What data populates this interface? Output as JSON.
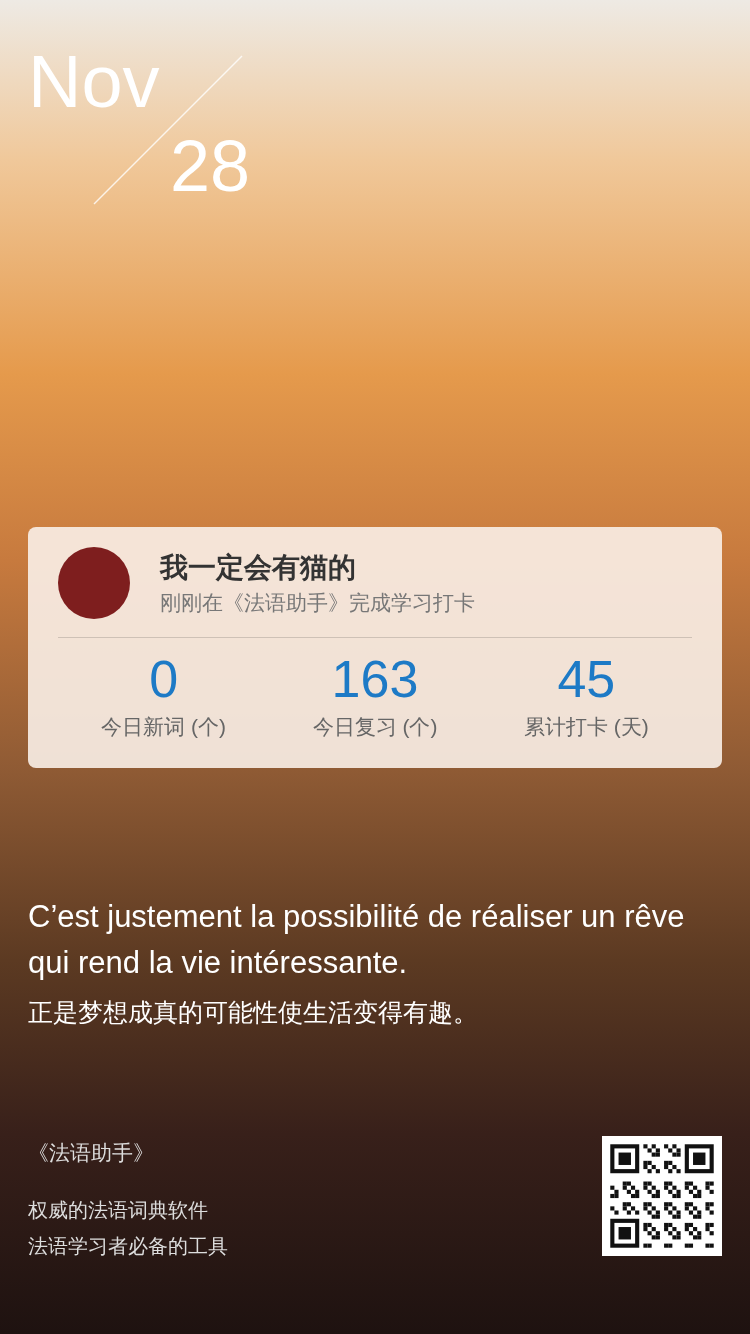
{
  "date": {
    "month": "Nov",
    "day": "28"
  },
  "card": {
    "user_name": "我一定会有猫的",
    "status": "刚刚在《法语助手》完成学习打卡",
    "stats": [
      {
        "value": "0",
        "label": "今日新词 (个)"
      },
      {
        "value": "163",
        "label": "今日复习 (个)"
      },
      {
        "value": "45",
        "label": "累计打卡 (天)"
      }
    ]
  },
  "quote": {
    "french": "C’est justement la possibilité de réaliser un rêve qui rend la vie intéressante.",
    "chinese": "正是梦想成真的可能性使生活变得有趣。"
  },
  "footer": {
    "app_name": "《法语助手》",
    "taglines": [
      "权威的法语词典软件",
      "法语学习者必备的工具"
    ]
  }
}
